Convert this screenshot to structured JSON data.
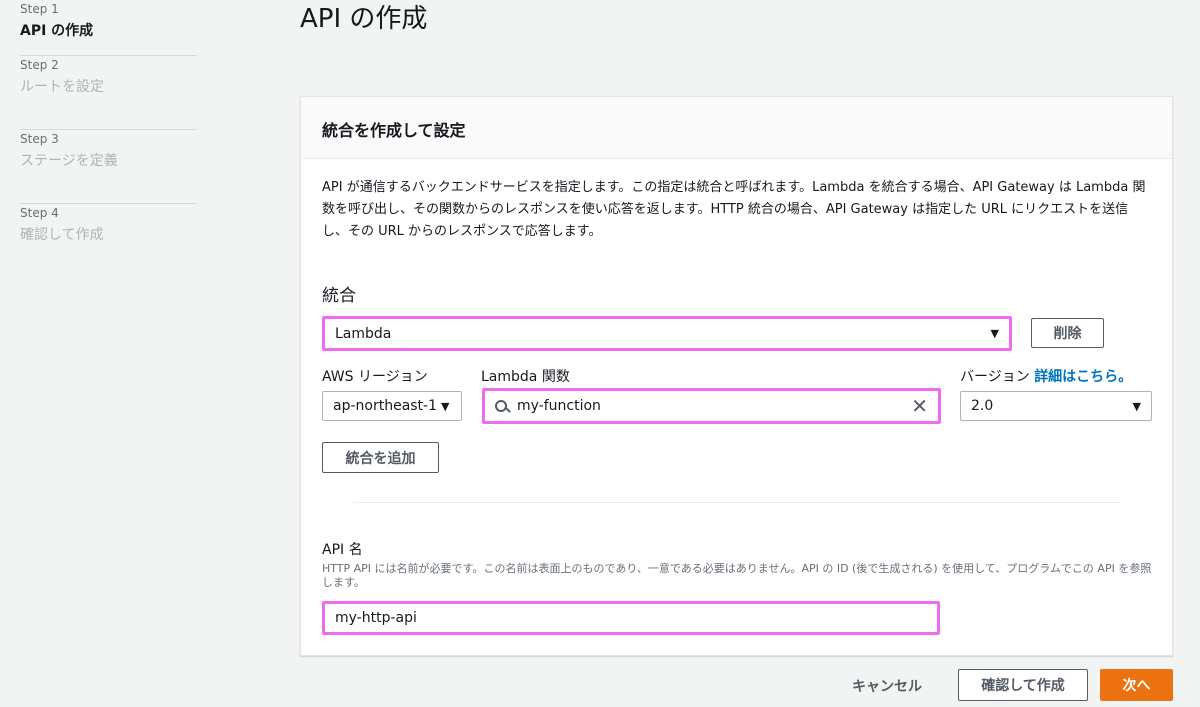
{
  "page": {
    "title": "API の作成"
  },
  "steps": [
    {
      "num": "Step 1",
      "title": "API の作成"
    },
    {
      "num": "Step 2",
      "title": "ルートを設定"
    },
    {
      "num": "Step 3",
      "title": "ステージを定義"
    },
    {
      "num": "Step 4",
      "title": "確認して作成"
    }
  ],
  "panel": {
    "header": "統合を作成して設定",
    "description": "API が通信するバックエンドサービスを指定します。この指定は統合と呼ばれます。Lambda を統合する場合、API Gateway は Lambda 関数を呼び出し、その関数からのレスポンスを使い応答を返します。HTTP 統合の場合、API Gateway は指定した URL にリクエストを送信し、その URL からのレスポンスで応答します。",
    "integration_label": "統合",
    "integration_value": "Lambda",
    "delete_label": "削除",
    "region_label": "AWS リージョン",
    "region_value": "ap-northeast-1",
    "function_label": "Lambda 関数",
    "function_value": "my-function",
    "version_label": "バージョン",
    "details_link": "詳細はこちら。",
    "version_value": "2.0",
    "add_integration_label": "統合を追加",
    "api_name_label": "API 名",
    "api_name_help": "HTTP API には名前が必要です。この名前は表面上のものであり、一意である必要はありません。API の ID (後で生成される) を使用して、プログラムでこの API を参照します。",
    "api_name_value": "my-http-api"
  },
  "footer": {
    "cancel": "キャンセル",
    "review": "確認して作成",
    "next": "次へ"
  },
  "colors": {
    "accent": "#ec7211",
    "link": "#0073bb",
    "highlight": "#ee6cf1"
  }
}
